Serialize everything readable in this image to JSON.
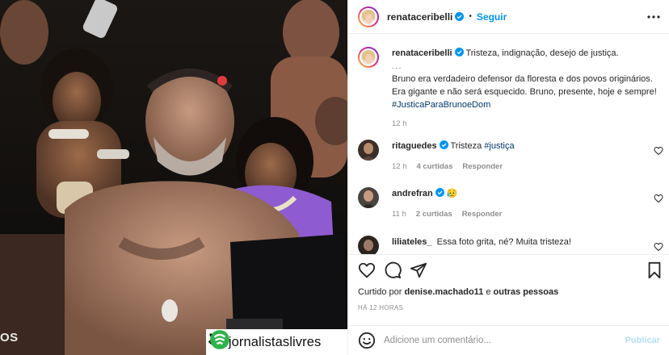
{
  "photo": {
    "bottom_left_partial_text": "OS",
    "repost_handle": "@jornalistaslivres"
  },
  "post": {
    "author": "renataceribelli",
    "follow_label": "Seguir",
    "caption_title": "Tristeza, indignação, desejo de justiça.",
    "caption_dots": ". . .",
    "caption_body": "Bruno era verdadeiro defensor da floresta e dos povos originários. Era gigante e não será esquecido. Bruno, presente, hoje e sempre! ",
    "caption_hashtag": "#JusticaParaBrunoeDom",
    "caption_time": "12 h"
  },
  "comments": [
    {
      "user": "ritaguedes",
      "text": "Tristeza ",
      "hashtag": "#justiça",
      "time": "12 h",
      "likes": "4 curtidas",
      "reply": "Responder"
    },
    {
      "user": "andrefran",
      "text": "😥",
      "time": "11 h",
      "likes": "2 curtidas",
      "reply": "Responder"
    },
    {
      "user": "liliateles_",
      "text": "Essa foto grita, né? Muita tristeza!"
    }
  ],
  "engagement": {
    "liked_by_prefix": "Curtido por ",
    "liked_by_user": "denise.machado11",
    "liked_by_suffix": " e ",
    "liked_by_others": "outras pessoas",
    "post_time": "HÁ 12 HORAS"
  },
  "composer": {
    "placeholder": "Adicione um comentário...",
    "publish_label": "Publicar"
  },
  "icons": {
    "more": "more-icon",
    "like": "heart-icon",
    "comment": "comment-icon",
    "share": "share-icon",
    "save": "bookmark-icon",
    "emoji": "emoji-icon",
    "verified": "verified-icon"
  },
  "colors": {
    "link": "#0095f6",
    "hashtag": "#00376b",
    "muted": "#8e8e8e",
    "publish_disabled": "#b2dffc"
  }
}
